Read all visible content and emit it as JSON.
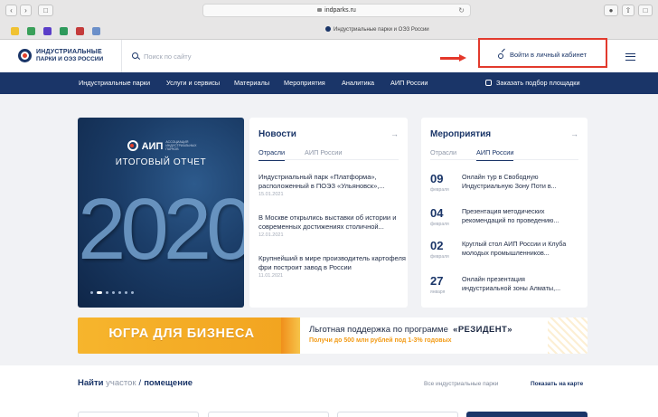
{
  "browser": {
    "url": "indparks.ru",
    "tab_title": "Индустриальные парки и ОЭЗ России",
    "icons": [
      "back-icon",
      "forward-icon",
      "sidebar-icon",
      "reload-icon",
      "download-icon",
      "share-icon",
      "new-tab-icon"
    ]
  },
  "header": {
    "logo_line1": "ИНДУСТРИАЛЬНЫЕ",
    "logo_line2": "ПАРКИ И ОЭЗ РОССИИ",
    "search_placeholder": "Поиск по сайту",
    "login_label": "Войти в личный кабинет",
    "annotation_color": "#e23a2d"
  },
  "nav": {
    "items": [
      "Индустриальные парки",
      "Услуги и сервисы",
      "Материалы",
      "Мероприятия",
      "Аналитика",
      "АИП России"
    ],
    "order_label": "Заказать подбор площадки"
  },
  "hero": {
    "brand": "АИП",
    "brand_sub": "АССОЦИАЦИЯ ИНДУСТРИАЛЬНЫХ ПАРКОВ",
    "title": "ИТОГОВЫЙ ОТЧЕТ",
    "year": "2020",
    "slides_total": 7,
    "slide_active": 2
  },
  "news": {
    "title": "Новости",
    "tabs": [
      "Отрасли",
      "АИП России"
    ],
    "active_tab": 0,
    "items": [
      {
        "title": "Индустриальный парк «Платформа», расположенный в ПОЭЗ «Ульяновск»,...",
        "date": "15.01.2021"
      },
      {
        "title": "В Москве открылись выставки об истории и современных достижениях столичной...",
        "date": "12.01.2021"
      },
      {
        "title": "Крупнейший в мире производитель картофеля фри построит завод в России",
        "date": "11.01.2021"
      }
    ]
  },
  "events": {
    "title": "Мероприятия",
    "tabs": [
      "Отрасли",
      "АИП России"
    ],
    "active_tab": 1,
    "items": [
      {
        "day": "09",
        "month": "февраля",
        "title": "Онлайн тур в Свободную Индустриальную Зону Поти в..."
      },
      {
        "day": "04",
        "month": "февраля",
        "title": "Презентация методических рекомендаций по проведению..."
      },
      {
        "day": "02",
        "month": "февраля",
        "title": "Круглый стол АИП России и Клуба молодых промышленников..."
      },
      {
        "day": "27",
        "month": "января",
        "title": "Онлайн презентация индустриальной зоны Алматы,..."
      }
    ]
  },
  "banner": {
    "left_text": "ЮГРА ДЛЯ БИЗНЕСА",
    "line1": "Льготная поддержка по программе",
    "program": "«РЕЗИДЕНТ»",
    "line2": "Получи до 500 млн рублей под 1-3% годовых",
    "accent": "#f29b16"
  },
  "find": {
    "word1": "Найти",
    "word2": "участок",
    "separator": "/",
    "word3": "помещение",
    "link_all": "Все индустриальные парки",
    "link_map": "Показать на карте"
  }
}
